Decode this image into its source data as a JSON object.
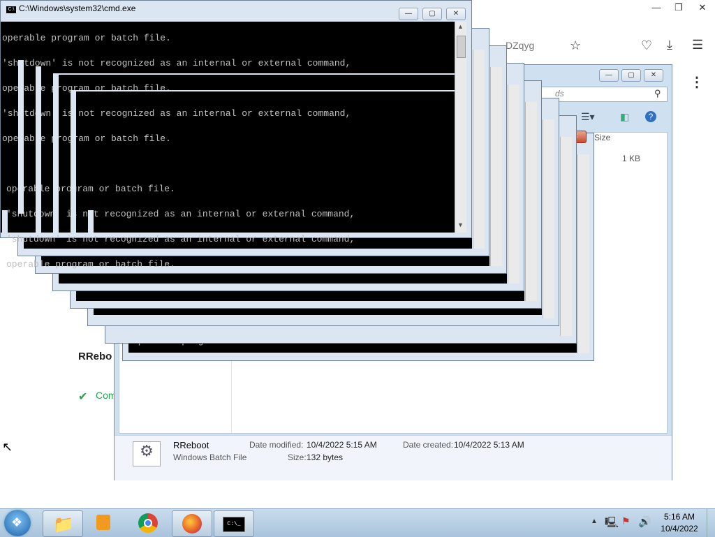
{
  "browser": {
    "url_fragment": "DZqyg",
    "search_placeholder": "ds",
    "page_heading_partial": "RRebo",
    "status_partial": "Com"
  },
  "explorer": {
    "column_size": "Size",
    "file_size_value": "1 KB",
    "details": {
      "file_name": "RReboot",
      "file_type": "Windows Batch File",
      "date_modified_label": "Date modified:",
      "date_modified_value": "10/4/2022 5:15 AM",
      "date_created_label": "Date created:",
      "date_created_value": "10/4/2022 5:13 AM",
      "size_label": "Size:",
      "size_value": "132 bytes"
    }
  },
  "cmd": {
    "title": "C:\\Windows\\system32\\cmd.exe",
    "lines_top": [
      "operable program or batch file.",
      "'shutdown' is not recognized as an internal or external command,",
      "operable program or batch file.",
      "'shutdown' is not recognized as an internal or external command,",
      "operable program or batch file."
    ],
    "lines_bottom": [
      "operable program or batch file.",
      "'shutdown' is not recognized as an internal or external command,",
      "'shutdown' is not recognized as an internal or external command,",
      "operable program or batch file."
    ],
    "line_lower": "operable program or batch file."
  },
  "taskbar": {
    "time": "5:16 AM",
    "date": "10/4/2022"
  },
  "icons": {
    "start": "windows-orb-icon",
    "explorer": "folder-icon",
    "media": "media-player-icon",
    "chrome": "chrome-icon",
    "firefox": "firefox-icon",
    "cmd": "cmd-icon"
  }
}
